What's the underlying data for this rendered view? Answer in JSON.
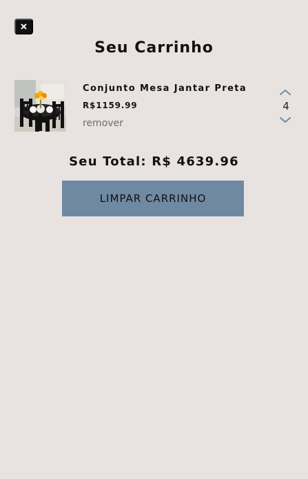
{
  "header": {
    "title": "Seu Carrinho",
    "close_icon": "close-icon"
  },
  "cart": {
    "items": [
      {
        "name": "Conjunto Mesa Jantar Preta",
        "price": "R$1159.99",
        "remove_label": "remover",
        "quantity": "4",
        "image_icon": "dining-set-image",
        "increase_icon": "chevron-up-icon",
        "decrease_icon": "chevron-down-icon"
      }
    ],
    "total": "Seu Total: R$ 4639.96",
    "clear_label": "LIMPAR CARRINHO"
  },
  "colors": {
    "background": "#e8e3e0",
    "button": "#6f89a3",
    "text": "#111111",
    "muted_text": "#6d6d6d"
  }
}
